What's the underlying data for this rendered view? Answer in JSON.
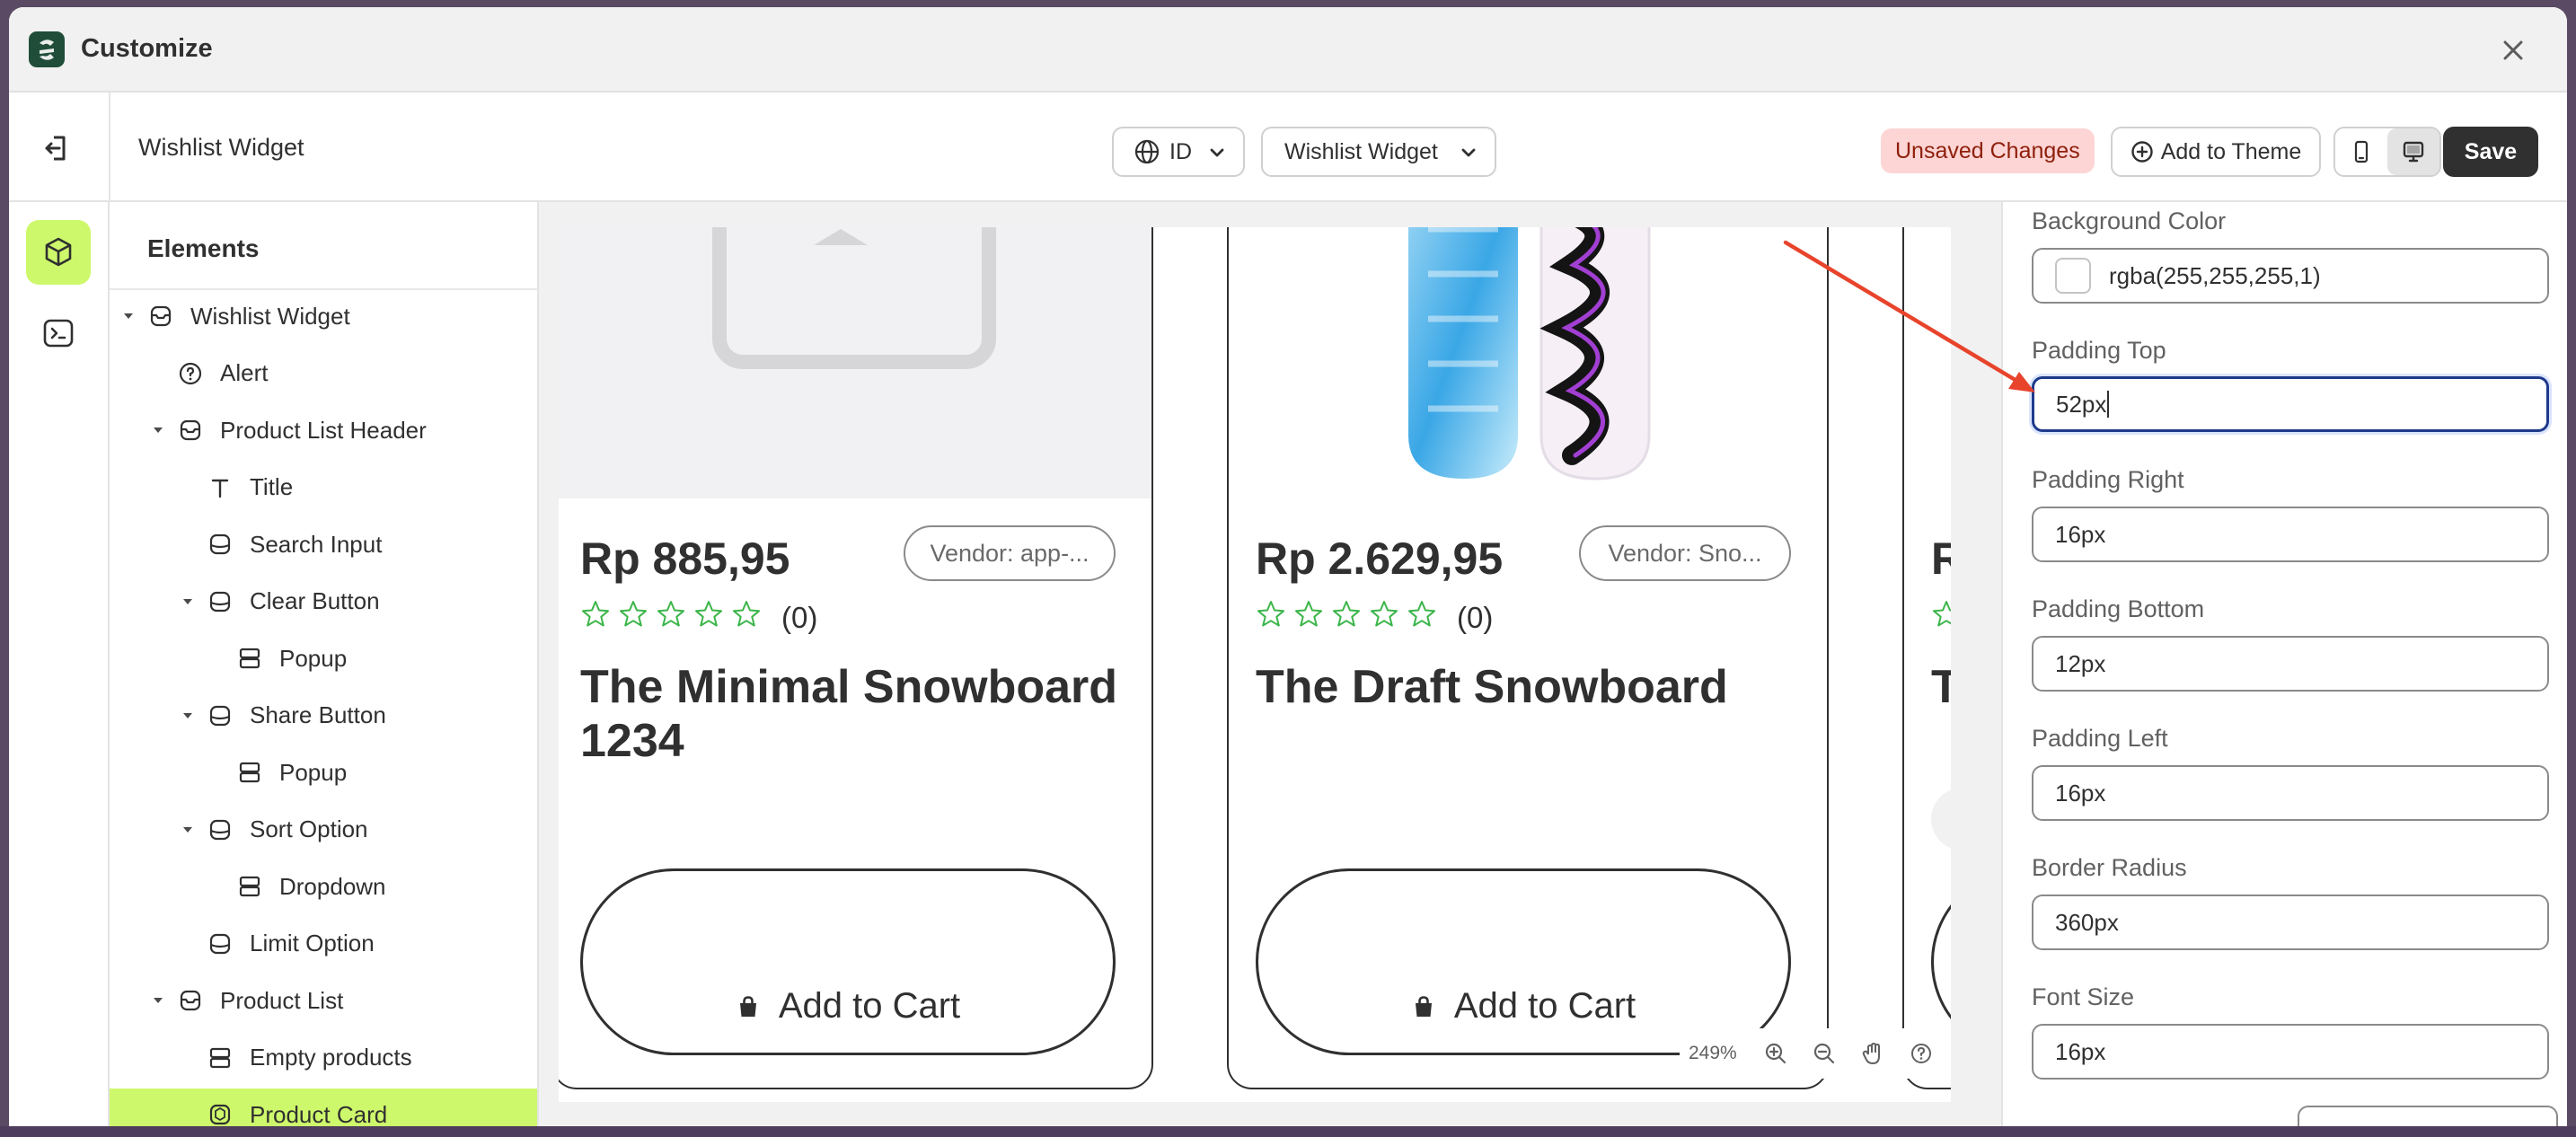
{
  "window": {
    "title": "Customize"
  },
  "header": {
    "page_name": "Wishlist Widget",
    "language": "ID",
    "widget": "Wishlist Widget",
    "unsaved": "Unsaved Changes",
    "add_to_theme": "Add to Theme",
    "save": "Save",
    "device_active": "desktop"
  },
  "elements": {
    "heading": "Elements",
    "items": [
      {
        "label": "Wishlist Widget",
        "icon": "section-icon",
        "expanded": true
      },
      {
        "label": "Alert",
        "icon": "help-circle-icon"
      },
      {
        "label": "Product List Header",
        "icon": "section-icon",
        "expanded": true
      },
      {
        "label": "Title",
        "icon": "text-icon"
      },
      {
        "label": "Search Input",
        "icon": "block-icon"
      },
      {
        "label": "Clear Button",
        "icon": "block-icon",
        "expanded": true
      },
      {
        "label": "Popup",
        "icon": "layout-icon"
      },
      {
        "label": "Share Button",
        "icon": "block-icon",
        "expanded": true
      },
      {
        "label": "Popup",
        "icon": "layout-icon"
      },
      {
        "label": "Sort Option",
        "icon": "block-icon",
        "expanded": true
      },
      {
        "label": "Dropdown",
        "icon": "layout-icon"
      },
      {
        "label": "Limit Option",
        "icon": "block-icon"
      },
      {
        "label": "Product List",
        "icon": "section-icon",
        "expanded": true
      },
      {
        "label": "Empty products",
        "icon": "layout-icon"
      },
      {
        "label": "Product Card",
        "icon": "product-icon",
        "selected": true
      }
    ]
  },
  "preview": {
    "cards": [
      {
        "price": "Rp 885,95",
        "vendor": "Vendor: app-...",
        "rating": "(0)",
        "title": "The Minimal Snowboard 1234",
        "cart": "Add to Cart"
      },
      {
        "price": "Rp 2.629,95",
        "vendor": "Vendor: Sno...",
        "rating": "(0)",
        "title": "The Draft Snowboard",
        "cart": "Add to Cart"
      },
      {
        "price": "R",
        "title": "T"
      }
    ],
    "zoom": "249%",
    "star_color": "#3cb54a"
  },
  "settings": {
    "background_color": {
      "label": "Background Color",
      "value": "rgba(255,255,255,1)"
    },
    "padding_top": {
      "label": "Padding Top",
      "value": "52px"
    },
    "padding_right": {
      "label": "Padding Right",
      "value": "16px"
    },
    "padding_bottom": {
      "label": "Padding Bottom",
      "value": "12px"
    },
    "padding_left": {
      "label": "Padding Left",
      "value": "16px"
    },
    "border_radius": {
      "label": "Border Radius",
      "value": "360px"
    },
    "font_size": {
      "label": "Font Size",
      "value": "16px"
    }
  },
  "colors": {
    "accent": "#cef86c",
    "save_bg": "#303030",
    "unsaved_bg": "#fdd5d5",
    "unsaved_text": "#8e1f0b",
    "arrow": "#e8442c"
  }
}
